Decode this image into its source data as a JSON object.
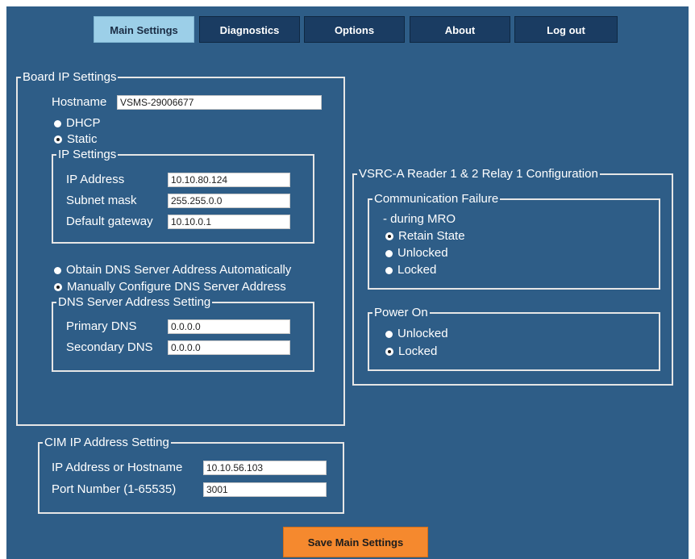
{
  "tabs": {
    "main_settings": "Main Settings",
    "diagnostics": "Diagnostics",
    "options": "Options",
    "about": "About",
    "logout": "Log out"
  },
  "board_ip": {
    "legend": "Board IP Settings",
    "hostname_label": "Hostname",
    "hostname_value": "VSMS-29006677",
    "dhcp_label": "DHCP",
    "static_label": "Static",
    "mode_selected": "Static",
    "ip_settings": {
      "legend": "IP Settings",
      "ip_label": "IP Address",
      "ip_value": "10.10.80.124",
      "subnet_label": "Subnet mask",
      "subnet_value": "255.255.0.0",
      "gateway_label": "Default gateway",
      "gateway_value": "10.10.0.1"
    },
    "dns_auto_label": "Obtain DNS Server Address Automatically",
    "dns_manual_label": "Manually Configure DNS Server Address",
    "dns_selected": "manual",
    "dns": {
      "legend": "DNS Server Address Setting",
      "primary_label": "Primary DNS",
      "primary_value": "0.0.0.0",
      "secondary_label": "Secondary DNS",
      "secondary_value": "0.0.0.0"
    }
  },
  "relay": {
    "legend": "VSRC-A Reader 1 & 2 Relay 1 Configuration",
    "comm_failure": {
      "legend": "Communication Failure",
      "subtitle": "- during MRO",
      "retain_label": "Retain State",
      "unlocked_label": "Unlocked",
      "locked_label": "Locked",
      "selected": "Retain State"
    },
    "power_on": {
      "legend": "Power On",
      "unlocked_label": "Unlocked",
      "locked_label": "Locked",
      "selected": "Locked"
    }
  },
  "cim": {
    "legend": "CIM IP Address Setting",
    "host_label": "IP Address or Hostname",
    "host_value": "10.10.56.103",
    "port_label": "Port Number (1-65535)",
    "port_value": "3001"
  },
  "save_label": "Save Main Settings",
  "colors": {
    "panel_bg": "#2e5d87",
    "tab_bg": "#1a3c62",
    "tab_active_bg": "#9ccfe8",
    "save_bg": "#f5892e"
  }
}
